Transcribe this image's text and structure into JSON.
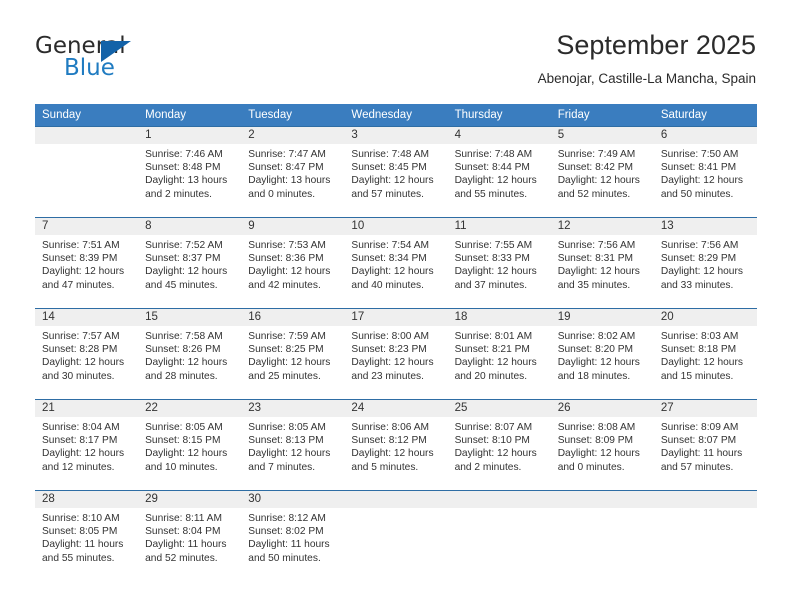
{
  "brand": {
    "name_top": "General",
    "name_bottom": "Blue",
    "triangle_color": "#1362a8",
    "blue_text_color": "#1f7bc1"
  },
  "header": {
    "title": "September 2025",
    "subtitle": "Abenojar, Castille-La Mancha, Spain"
  },
  "theme": {
    "header_row_bg": "#3a7dbf",
    "row_divider": "#2e6da4",
    "daynum_bg": "#efefef",
    "text": "#333333"
  },
  "weekdays": [
    "Sunday",
    "Monday",
    "Tuesday",
    "Wednesday",
    "Thursday",
    "Friday",
    "Saturday"
  ],
  "weeks": [
    [
      {
        "day": "",
        "sunrise": "",
        "sunset": "",
        "daylight_line1": "",
        "daylight_line2": ""
      },
      {
        "day": "1",
        "sunrise": "Sunrise: 7:46 AM",
        "sunset": "Sunset: 8:48 PM",
        "daylight_line1": "Daylight: 13 hours",
        "daylight_line2": "and 2 minutes."
      },
      {
        "day": "2",
        "sunrise": "Sunrise: 7:47 AM",
        "sunset": "Sunset: 8:47 PM",
        "daylight_line1": "Daylight: 13 hours",
        "daylight_line2": "and 0 minutes."
      },
      {
        "day": "3",
        "sunrise": "Sunrise: 7:48 AM",
        "sunset": "Sunset: 8:45 PM",
        "daylight_line1": "Daylight: 12 hours",
        "daylight_line2": "and 57 minutes."
      },
      {
        "day": "4",
        "sunrise": "Sunrise: 7:48 AM",
        "sunset": "Sunset: 8:44 PM",
        "daylight_line1": "Daylight: 12 hours",
        "daylight_line2": "and 55 minutes."
      },
      {
        "day": "5",
        "sunrise": "Sunrise: 7:49 AM",
        "sunset": "Sunset: 8:42 PM",
        "daylight_line1": "Daylight: 12 hours",
        "daylight_line2": "and 52 minutes."
      },
      {
        "day": "6",
        "sunrise": "Sunrise: 7:50 AM",
        "sunset": "Sunset: 8:41 PM",
        "daylight_line1": "Daylight: 12 hours",
        "daylight_line2": "and 50 minutes."
      }
    ],
    [
      {
        "day": "7",
        "sunrise": "Sunrise: 7:51 AM",
        "sunset": "Sunset: 8:39 PM",
        "daylight_line1": "Daylight: 12 hours",
        "daylight_line2": "and 47 minutes."
      },
      {
        "day": "8",
        "sunrise": "Sunrise: 7:52 AM",
        "sunset": "Sunset: 8:37 PM",
        "daylight_line1": "Daylight: 12 hours",
        "daylight_line2": "and 45 minutes."
      },
      {
        "day": "9",
        "sunrise": "Sunrise: 7:53 AM",
        "sunset": "Sunset: 8:36 PM",
        "daylight_line1": "Daylight: 12 hours",
        "daylight_line2": "and 42 minutes."
      },
      {
        "day": "10",
        "sunrise": "Sunrise: 7:54 AM",
        "sunset": "Sunset: 8:34 PM",
        "daylight_line1": "Daylight: 12 hours",
        "daylight_line2": "and 40 minutes."
      },
      {
        "day": "11",
        "sunrise": "Sunrise: 7:55 AM",
        "sunset": "Sunset: 8:33 PM",
        "daylight_line1": "Daylight: 12 hours",
        "daylight_line2": "and 37 minutes."
      },
      {
        "day": "12",
        "sunrise": "Sunrise: 7:56 AM",
        "sunset": "Sunset: 8:31 PM",
        "daylight_line1": "Daylight: 12 hours",
        "daylight_line2": "and 35 minutes."
      },
      {
        "day": "13",
        "sunrise": "Sunrise: 7:56 AM",
        "sunset": "Sunset: 8:29 PM",
        "daylight_line1": "Daylight: 12 hours",
        "daylight_line2": "and 33 minutes."
      }
    ],
    [
      {
        "day": "14",
        "sunrise": "Sunrise: 7:57 AM",
        "sunset": "Sunset: 8:28 PM",
        "daylight_line1": "Daylight: 12 hours",
        "daylight_line2": "and 30 minutes."
      },
      {
        "day": "15",
        "sunrise": "Sunrise: 7:58 AM",
        "sunset": "Sunset: 8:26 PM",
        "daylight_line1": "Daylight: 12 hours",
        "daylight_line2": "and 28 minutes."
      },
      {
        "day": "16",
        "sunrise": "Sunrise: 7:59 AM",
        "sunset": "Sunset: 8:25 PM",
        "daylight_line1": "Daylight: 12 hours",
        "daylight_line2": "and 25 minutes."
      },
      {
        "day": "17",
        "sunrise": "Sunrise: 8:00 AM",
        "sunset": "Sunset: 8:23 PM",
        "daylight_line1": "Daylight: 12 hours",
        "daylight_line2": "and 23 minutes."
      },
      {
        "day": "18",
        "sunrise": "Sunrise: 8:01 AM",
        "sunset": "Sunset: 8:21 PM",
        "daylight_line1": "Daylight: 12 hours",
        "daylight_line2": "and 20 minutes."
      },
      {
        "day": "19",
        "sunrise": "Sunrise: 8:02 AM",
        "sunset": "Sunset: 8:20 PM",
        "daylight_line1": "Daylight: 12 hours",
        "daylight_line2": "and 18 minutes."
      },
      {
        "day": "20",
        "sunrise": "Sunrise: 8:03 AM",
        "sunset": "Sunset: 8:18 PM",
        "daylight_line1": "Daylight: 12 hours",
        "daylight_line2": "and 15 minutes."
      }
    ],
    [
      {
        "day": "21",
        "sunrise": "Sunrise: 8:04 AM",
        "sunset": "Sunset: 8:17 PM",
        "daylight_line1": "Daylight: 12 hours",
        "daylight_line2": "and 12 minutes."
      },
      {
        "day": "22",
        "sunrise": "Sunrise: 8:05 AM",
        "sunset": "Sunset: 8:15 PM",
        "daylight_line1": "Daylight: 12 hours",
        "daylight_line2": "and 10 minutes."
      },
      {
        "day": "23",
        "sunrise": "Sunrise: 8:05 AM",
        "sunset": "Sunset: 8:13 PM",
        "daylight_line1": "Daylight: 12 hours",
        "daylight_line2": "and 7 minutes."
      },
      {
        "day": "24",
        "sunrise": "Sunrise: 8:06 AM",
        "sunset": "Sunset: 8:12 PM",
        "daylight_line1": "Daylight: 12 hours",
        "daylight_line2": "and 5 minutes."
      },
      {
        "day": "25",
        "sunrise": "Sunrise: 8:07 AM",
        "sunset": "Sunset: 8:10 PM",
        "daylight_line1": "Daylight: 12 hours",
        "daylight_line2": "and 2 minutes."
      },
      {
        "day": "26",
        "sunrise": "Sunrise: 8:08 AM",
        "sunset": "Sunset: 8:09 PM",
        "daylight_line1": "Daylight: 12 hours",
        "daylight_line2": "and 0 minutes."
      },
      {
        "day": "27",
        "sunrise": "Sunrise: 8:09 AM",
        "sunset": "Sunset: 8:07 PM",
        "daylight_line1": "Daylight: 11 hours",
        "daylight_line2": "and 57 minutes."
      }
    ],
    [
      {
        "day": "28",
        "sunrise": "Sunrise: 8:10 AM",
        "sunset": "Sunset: 8:05 PM",
        "daylight_line1": "Daylight: 11 hours",
        "daylight_line2": "and 55 minutes."
      },
      {
        "day": "29",
        "sunrise": "Sunrise: 8:11 AM",
        "sunset": "Sunset: 8:04 PM",
        "daylight_line1": "Daylight: 11 hours",
        "daylight_line2": "and 52 minutes."
      },
      {
        "day": "30",
        "sunrise": "Sunrise: 8:12 AM",
        "sunset": "Sunset: 8:02 PM",
        "daylight_line1": "Daylight: 11 hours",
        "daylight_line2": "and 50 minutes."
      },
      {
        "day": "",
        "sunrise": "",
        "sunset": "",
        "daylight_line1": "",
        "daylight_line2": ""
      },
      {
        "day": "",
        "sunrise": "",
        "sunset": "",
        "daylight_line1": "",
        "daylight_line2": ""
      },
      {
        "day": "",
        "sunrise": "",
        "sunset": "",
        "daylight_line1": "",
        "daylight_line2": ""
      },
      {
        "day": "",
        "sunrise": "",
        "sunset": "",
        "daylight_line1": "",
        "daylight_line2": ""
      }
    ]
  ]
}
